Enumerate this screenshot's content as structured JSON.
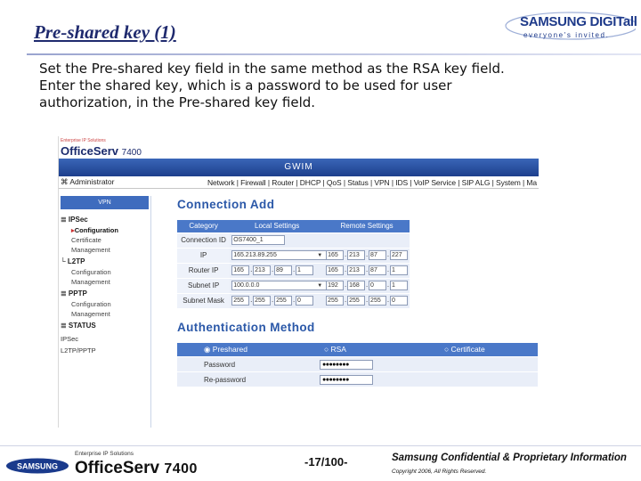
{
  "slide": {
    "title": "Pre-shared key (1)",
    "body": "Set the Pre-shared key field in the same method as the RSA key field.\nEnter the shared key, which is a password to be used for user\nauthorization, in the Pre-shared key field.",
    "brand_main": "SAMSUNG DIGITall",
    "brand_tagline": "everyone's invited."
  },
  "screenshot": {
    "solutions_label": "Enterprise IP Solutions",
    "product_name": "OfficeServ",
    "product_model": "7400",
    "gwim_title": "GWIM",
    "user_label": "⌘ Administrator",
    "menu": "Network | Firewall | Router | DHCP | QoS | Status | VPN | IDS | VoIP Service | SIP ALG | System | Ma",
    "sidebar": {
      "tab": "VPN",
      "sections": [
        {
          "label": "≣ IPSec",
          "items": [
            "Configuration",
            "Certificate",
            "Management"
          ],
          "active": 0
        },
        {
          "label": "└ L2TP",
          "items": [
            "Configuration",
            "Management"
          ],
          "active": -1
        },
        {
          "label": "≣ PPTP",
          "items": [
            "Configuration",
            "Management"
          ],
          "active": -1
        },
        {
          "label": "≣ STATUS",
          "items": [],
          "active": -1
        }
      ],
      "status_items": [
        "IPSec",
        "L2TP/PPTP"
      ]
    },
    "connection_add": {
      "title": "Connection Add",
      "headers": [
        "Category",
        "Local Settings",
        "Remote Settings"
      ],
      "rows": [
        {
          "label": "Connection ID",
          "local": [
            "OS7400_1"
          ],
          "remote": []
        },
        {
          "label": "IP",
          "local": [
            "165.213.89.255"
          ],
          "remote": [
            "165",
            "213",
            "87",
            "227"
          ]
        },
        {
          "label": "Router IP",
          "local": [
            "165",
            "213",
            "89",
            "1"
          ],
          "remote": [
            "165",
            "213",
            "87",
            "1"
          ]
        },
        {
          "label": "Subnet IP",
          "local": [
            "100.0.0.0"
          ],
          "remote": [
            "192",
            "168",
            "0",
            "1"
          ]
        },
        {
          "label": "Subnet Mask",
          "local": [
            "255",
            "255",
            "255",
            "0"
          ],
          "remote": [
            "255",
            "255",
            "255",
            "0"
          ]
        }
      ]
    },
    "auth": {
      "title": "Authentication Method",
      "options": [
        "◉ Preshared",
        "○ RSA",
        "○ Certificate"
      ],
      "rows": [
        {
          "label": "Password",
          "value": "●●●●●●●●"
        },
        {
          "label": "Re-password",
          "value": "●●●●●●●●"
        }
      ]
    }
  },
  "footer": {
    "badge": "SAMSUNG",
    "solutions": "Enterprise IP Solutions",
    "product": "OfficeServ",
    "model": "7400",
    "page": "-17/100-",
    "confidential": "Samsung Confidential & Proprietary Information",
    "copyright": "Copyright 2006, All Rights Reserved."
  },
  "colors": {
    "title": "#1f2a6e",
    "accent": "#2b58a8",
    "table_header": "#4a78c8",
    "gwim_bar": "#1d3f8c"
  }
}
